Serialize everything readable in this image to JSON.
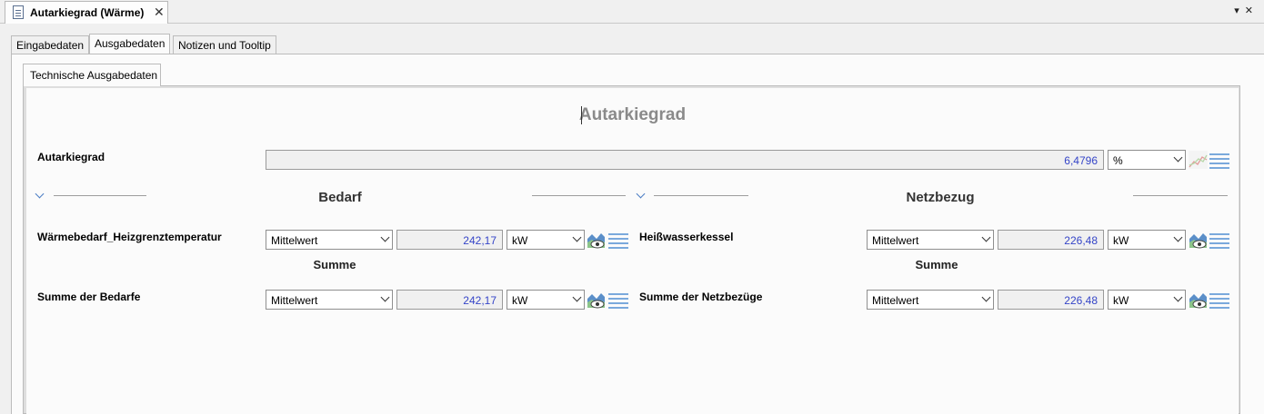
{
  "document_tab": {
    "title": "Autarkiegrad (Wärme)",
    "close_glyph": "✕"
  },
  "window_controls": {
    "menu_glyph": "▾",
    "close_glyph": "✕"
  },
  "tabs": [
    {
      "label": "Eingabedaten",
      "active": false
    },
    {
      "label": "Ausgabedaten",
      "active": true
    },
    {
      "label": "Notizen und Tooltip",
      "active": false
    }
  ],
  "subtab": {
    "label": "Technische Ausgabedaten"
  },
  "heading": "Autarkiegrad",
  "autarkie": {
    "label": "Autarkiegrad",
    "value": "6,4796",
    "unit": "%"
  },
  "bedarf": {
    "title": "Bedarf",
    "row1": {
      "label": "Wärmebedarf_Heizgrenztemperatur",
      "mode": "Mittelwert",
      "value": "242,17",
      "unit": "kW"
    },
    "sum_title": "Summe",
    "row2": {
      "label": "Summe der Bedarfe",
      "mode": "Mittelwert",
      "value": "242,17",
      "unit": "kW"
    }
  },
  "netzbezug": {
    "title": "Netzbezug",
    "row1": {
      "label": "Heißwasserkessel",
      "mode": "Mittelwert",
      "value": "226,48",
      "unit": "kW"
    },
    "sum_title": "Summe",
    "row2": {
      "label": "Summe der Netzbezüge",
      "mode": "Mittelwert",
      "value": "226,48",
      "unit": "kW"
    }
  },
  "icons": {
    "chart": "chart-eye-icon",
    "list": "list-icon",
    "document": "document-icon",
    "collapse": "chevron-down-icon"
  },
  "colors": {
    "value_text": "#3545c8",
    "list_icon": "#7aa9dc",
    "heading": "#8a8a8a"
  }
}
